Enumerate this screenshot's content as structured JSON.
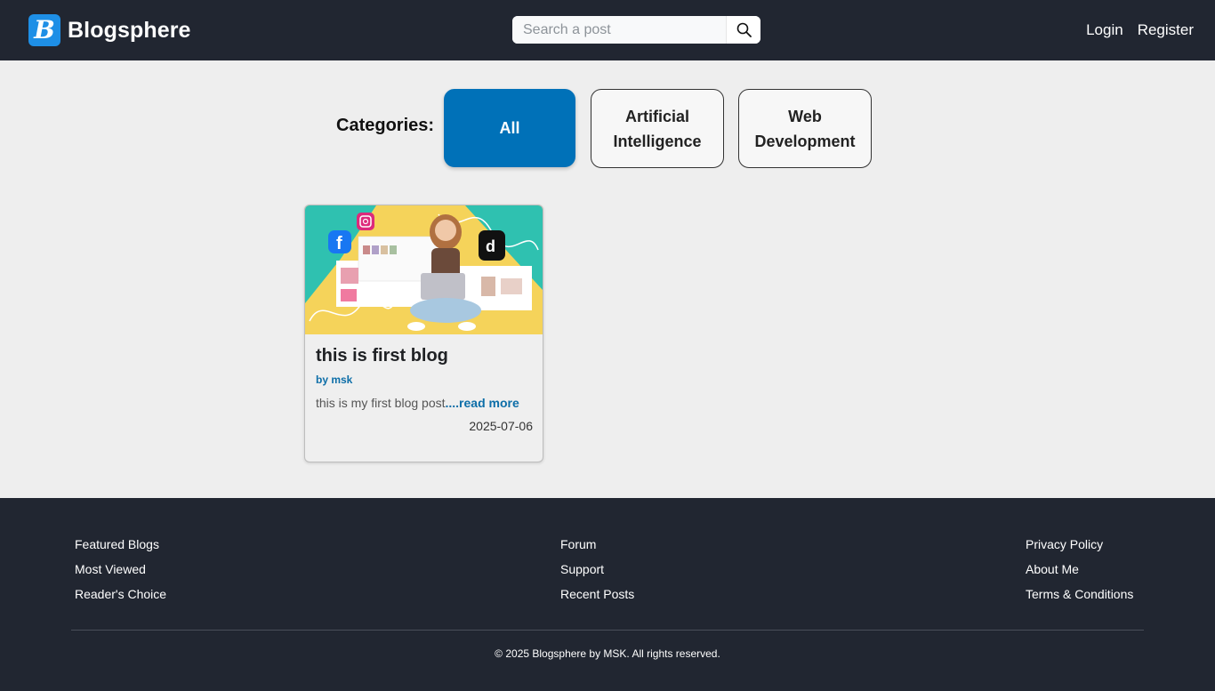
{
  "header": {
    "logo_letter": "B",
    "brand_name": "Blogsphere",
    "search_placeholder": "Search a post",
    "search_icon": "search-icon",
    "login_label": "Login",
    "register_label": "Register"
  },
  "categories": {
    "label": "Categories:",
    "items": [
      {
        "label": "All",
        "active": true
      },
      {
        "label": "Artificial Intelligence",
        "active": false
      },
      {
        "label": "Web Development",
        "active": false
      }
    ]
  },
  "posts": [
    {
      "title": "this is first blog",
      "author": "by msk",
      "excerpt": "this is my first blog post",
      "read_more": "....read more",
      "date": "2025-07-06"
    }
  ],
  "footer": {
    "col1": [
      "Featured Blogs",
      "Most Viewed",
      "Reader's Choice"
    ],
    "col2": [
      "Forum",
      "Support",
      "Recent Posts"
    ],
    "col3": [
      "Privacy Policy",
      "About Me",
      "Terms & Conditions"
    ],
    "copyright": "© 2025 Blogsphere by MSK. All rights reserved."
  },
  "colors": {
    "header_bg": "#212631",
    "accent": "#0071b8",
    "logo": "#1e8fe6",
    "page_bg": "#eeeeee"
  }
}
